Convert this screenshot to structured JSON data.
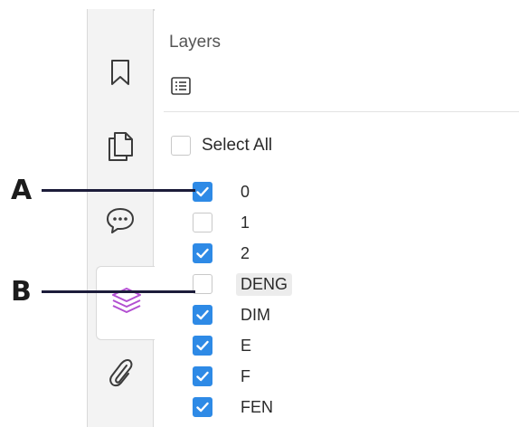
{
  "panel": {
    "title": "Layers",
    "options_icon": "list-options-icon",
    "select_all": {
      "label": "Select All",
      "checked": false
    }
  },
  "sidebar": {
    "items": [
      {
        "name": "bookmarks",
        "icon": "bookmark-icon",
        "active": false
      },
      {
        "name": "pages",
        "icon": "pages-icon",
        "active": false
      },
      {
        "name": "comments",
        "icon": "comment-icon",
        "active": false
      },
      {
        "name": "layers",
        "icon": "layers-icon",
        "active": true
      },
      {
        "name": "attachments",
        "icon": "paperclip-icon",
        "active": false
      }
    ]
  },
  "layers": [
    {
      "label": "0",
      "checked": true
    },
    {
      "label": "1",
      "checked": false
    },
    {
      "label": "2",
      "checked": true
    },
    {
      "label": "DENG",
      "checked": false,
      "highlighted": true
    },
    {
      "label": "DIM",
      "checked": true
    },
    {
      "label": "E",
      "checked": true
    },
    {
      "label": "F",
      "checked": true
    },
    {
      "label": "FEN",
      "checked": true
    }
  ],
  "callouts": [
    {
      "letter": "A",
      "target": "layer 0 checkbox"
    },
    {
      "letter": "B",
      "target": "layer DENG checkbox"
    }
  ],
  "colors": {
    "checkbox_checked": "#2e8ae6",
    "layers_icon_accent": "#b24fd1",
    "callout_line": "#1c1c3a"
  }
}
